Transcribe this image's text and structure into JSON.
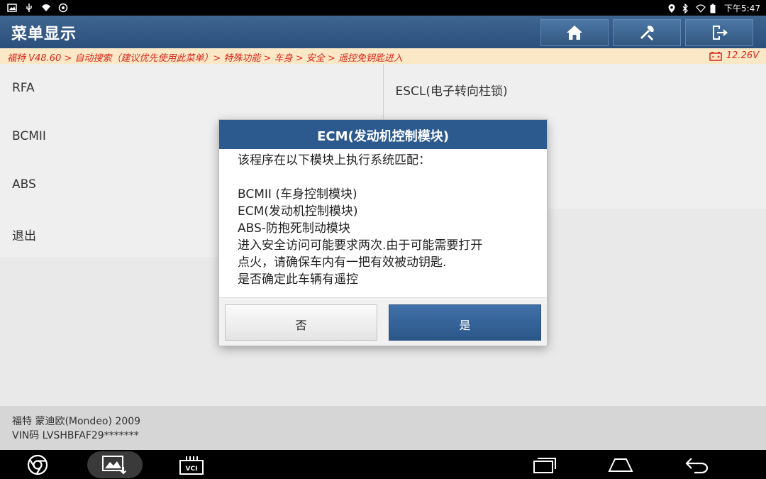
{
  "status_bar": {
    "time": "下午5:47"
  },
  "header": {
    "title": "菜单显示"
  },
  "breadcrumb": {
    "path": "福特 V48.60 > 自动搜索（建议优先使用此菜单）> 特殊功能 > 车身 > 安全 > 遥控免钥匙进入",
    "voltage": "12.26V"
  },
  "menu": {
    "rows": [
      {
        "left": "RFA",
        "right": "ESCL(电子转向柱锁)"
      },
      {
        "left": "BCMII",
        "right": ""
      },
      {
        "left": "ABS",
        "right": ""
      },
      {
        "left": "退出",
        "right": ""
      }
    ]
  },
  "vehicle": {
    "model": "福特 蒙迪欧(Mondeo) 2009",
    "vin": "VIN码 LVSHBFAF29*******"
  },
  "dialog": {
    "title": "ECM(发动机控制模块)",
    "lines": [
      "该程序在以下模块上执行系统匹配：",
      "",
      "BCMII (车身控制模块)",
      "ECM(发动机控制模块)",
      "ABS-防抱死制动模块",
      "进入安全访问可能要求两次.由于可能需要打开",
      "点火，请确保车内有一把有效被动钥匙.",
      "是否确定此车辆有遥控"
    ],
    "no_label": "否",
    "yes_label": "是"
  },
  "colors": {
    "header": "#2c4f7c",
    "breadcrumb_bg": "#fbe8c7",
    "breadcrumb_text": "#d9281c",
    "dialog_title": "#2d5a8e",
    "yes_button": "#2b5688"
  }
}
